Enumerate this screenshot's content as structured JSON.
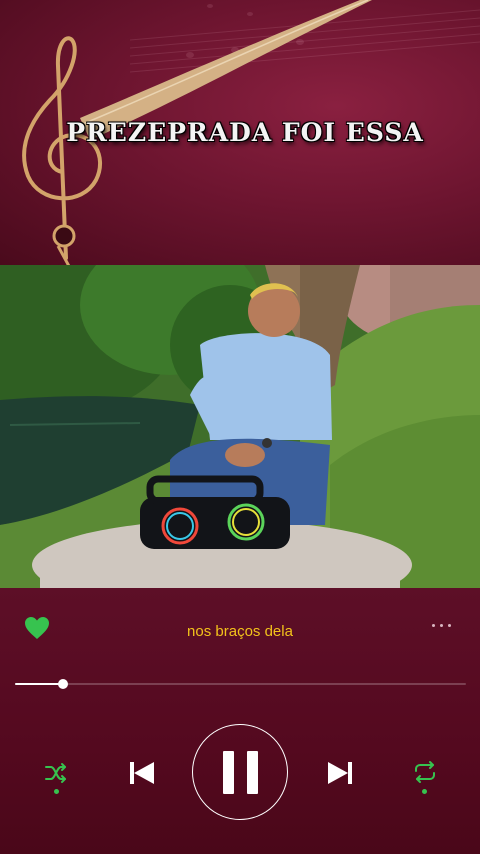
{
  "banner": {
    "title": "PREZEPRADA FOI ESSA"
  },
  "player": {
    "lyric": "nos braços dela",
    "liked": true,
    "progress_fraction": 0.107,
    "shuffle_active": true,
    "repeat_active": true,
    "state": "playing"
  },
  "icons": {
    "like": "heart-icon",
    "more": "more-options-icon",
    "shuffle": "shuffle-icon",
    "previous": "skip-previous-icon",
    "pause": "pause-icon",
    "next": "skip-next-icon",
    "repeat": "repeat-icon",
    "banner_art": "treble-clef-icon"
  },
  "colors": {
    "background": "#5a0f25",
    "accent_green": "#37c34f",
    "lyric_yellow": "#f2c21b"
  }
}
